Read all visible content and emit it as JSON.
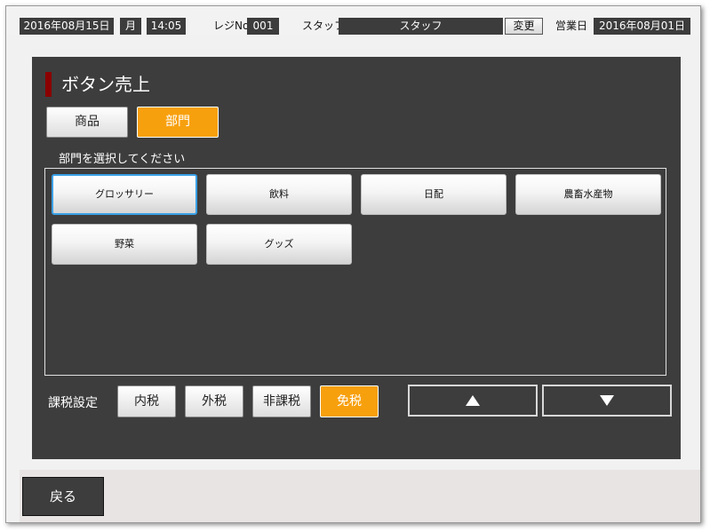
{
  "header": {
    "current_date": "2016年08月15日",
    "weekday": "月",
    "time": "14:05",
    "register_label": "レジNo",
    "register_no": "001",
    "staff_label": "スタッフ",
    "staff_value": "スタッフ",
    "change_label": "変更",
    "business_day_label": "営業日",
    "business_day": "2016年08月01日"
  },
  "page": {
    "title": "ボタン売上",
    "mode_tabs": [
      {
        "label": "商品",
        "active": false
      },
      {
        "label": "部門",
        "active": true
      }
    ],
    "instruction": "部門を選択してください",
    "departments": [
      {
        "label": "グロッサリー",
        "selected": true
      },
      {
        "label": "飲料",
        "selected": false
      },
      {
        "label": "日配",
        "selected": false
      },
      {
        "label": "農畜水産物",
        "selected": false
      },
      {
        "label": "野菜",
        "selected": false
      },
      {
        "label": "グッズ",
        "selected": false
      }
    ],
    "tax": {
      "label": "課税設定",
      "options": [
        {
          "label": "内税",
          "active": false
        },
        {
          "label": "外税",
          "active": false
        },
        {
          "label": "非課税",
          "active": false
        },
        {
          "label": "免税",
          "active": true
        }
      ]
    },
    "scroll": {
      "up_icon": "triangle-up-icon",
      "down_icon": "triangle-down-icon"
    }
  },
  "footer": {
    "back_label": "戻る"
  },
  "colors": {
    "accent": "#f7a00e",
    "panel": "#3d3d3d",
    "title_mark": "#8b0000",
    "selection_border": "#3aa0e6"
  }
}
